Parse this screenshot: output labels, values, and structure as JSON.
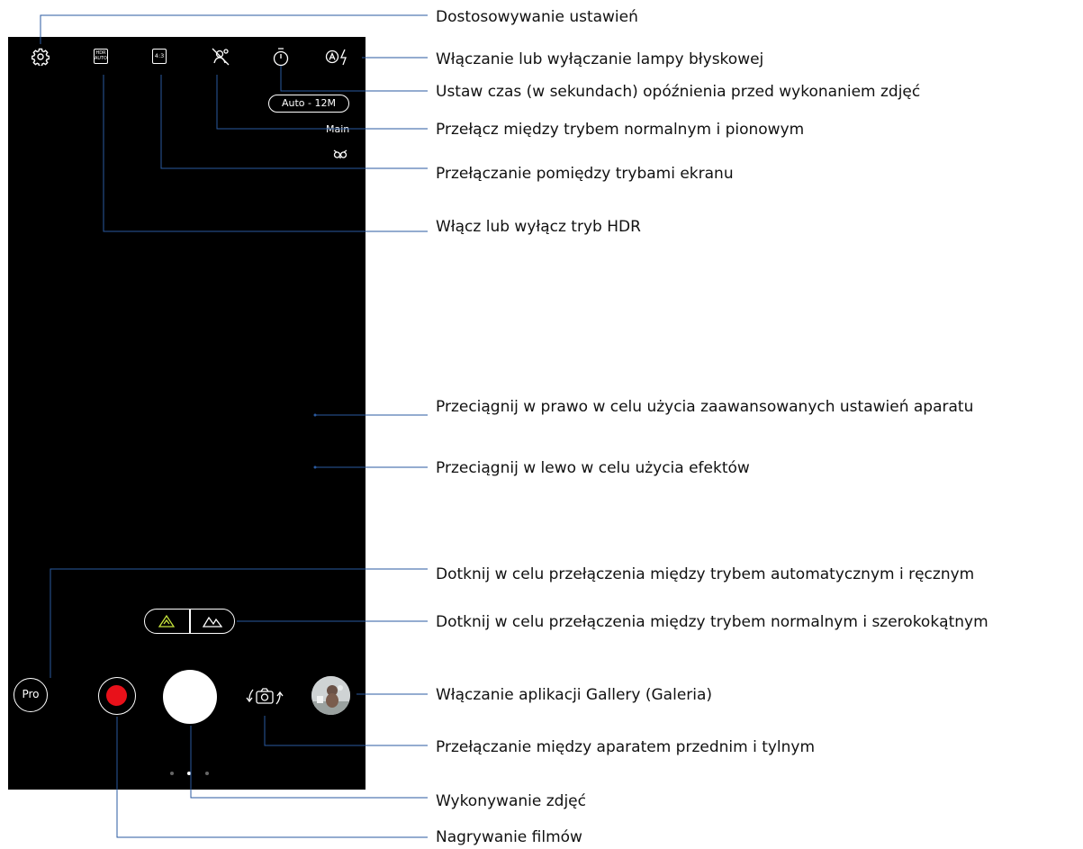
{
  "colors": {
    "screen_bg": "#000000",
    "icon": "#ffffff",
    "record": "#e8111a",
    "lens_active": "#c8e63c",
    "callout_line": "#2a5aa0",
    "label_text": "#111111"
  },
  "icons": {
    "settings": "gear-icon",
    "hdr": "hdr-auto-icon",
    "hdr_text": "HDR AUTO",
    "aspect": "aspect-ratio-icon",
    "aspect_text": "4:3",
    "portrait": "portrait-mode-icon",
    "timer": "timer-icon",
    "flash": "auto-flash-icon",
    "beauty": "beauty-owl-icon",
    "lens_normal": "normal-lens-icon",
    "lens_wide": "wide-lens-icon",
    "switch_camera": "switch-camera-icon"
  },
  "camera": {
    "resolution": "Auto - 12M",
    "lens_label": "Main",
    "pro_label": "Pro",
    "page_dots": 3,
    "active_dot": 2
  },
  "callouts": {
    "settings": "Dostosowywanie ustawień",
    "flash": "Włączanie lub wyłączanie lampy błyskowej",
    "timer": "Ustaw czas (w sekundach) opóźnienia przed wykonaniem zdjęć",
    "portrait": "Przełącz między trybem normalnym i pionowym",
    "aspect": "Przełączanie pomiędzy trybami ekranu",
    "hdr": "Włącz lub wyłącz tryb HDR",
    "swipe_right": "Przeciągnij w prawo w celu użycia zaawansowanych ustawień aparatu",
    "swipe_left": "Przeciągnij w lewo w celu użycia efektów",
    "pro_mode": "Dotknij w celu przełączenia między trybem automatycznym i ręcznym",
    "lens_mode": "Dotknij w celu przełączenia między trybem normalnym i szerokokątnym",
    "gallery": "Włączanie aplikacji Gallery (Galeria)",
    "switch_camera": "Przełączanie między aparatem przednim i tylnym",
    "shutter": "Wykonywanie zdjęć",
    "record": "Nagrywanie filmów"
  }
}
